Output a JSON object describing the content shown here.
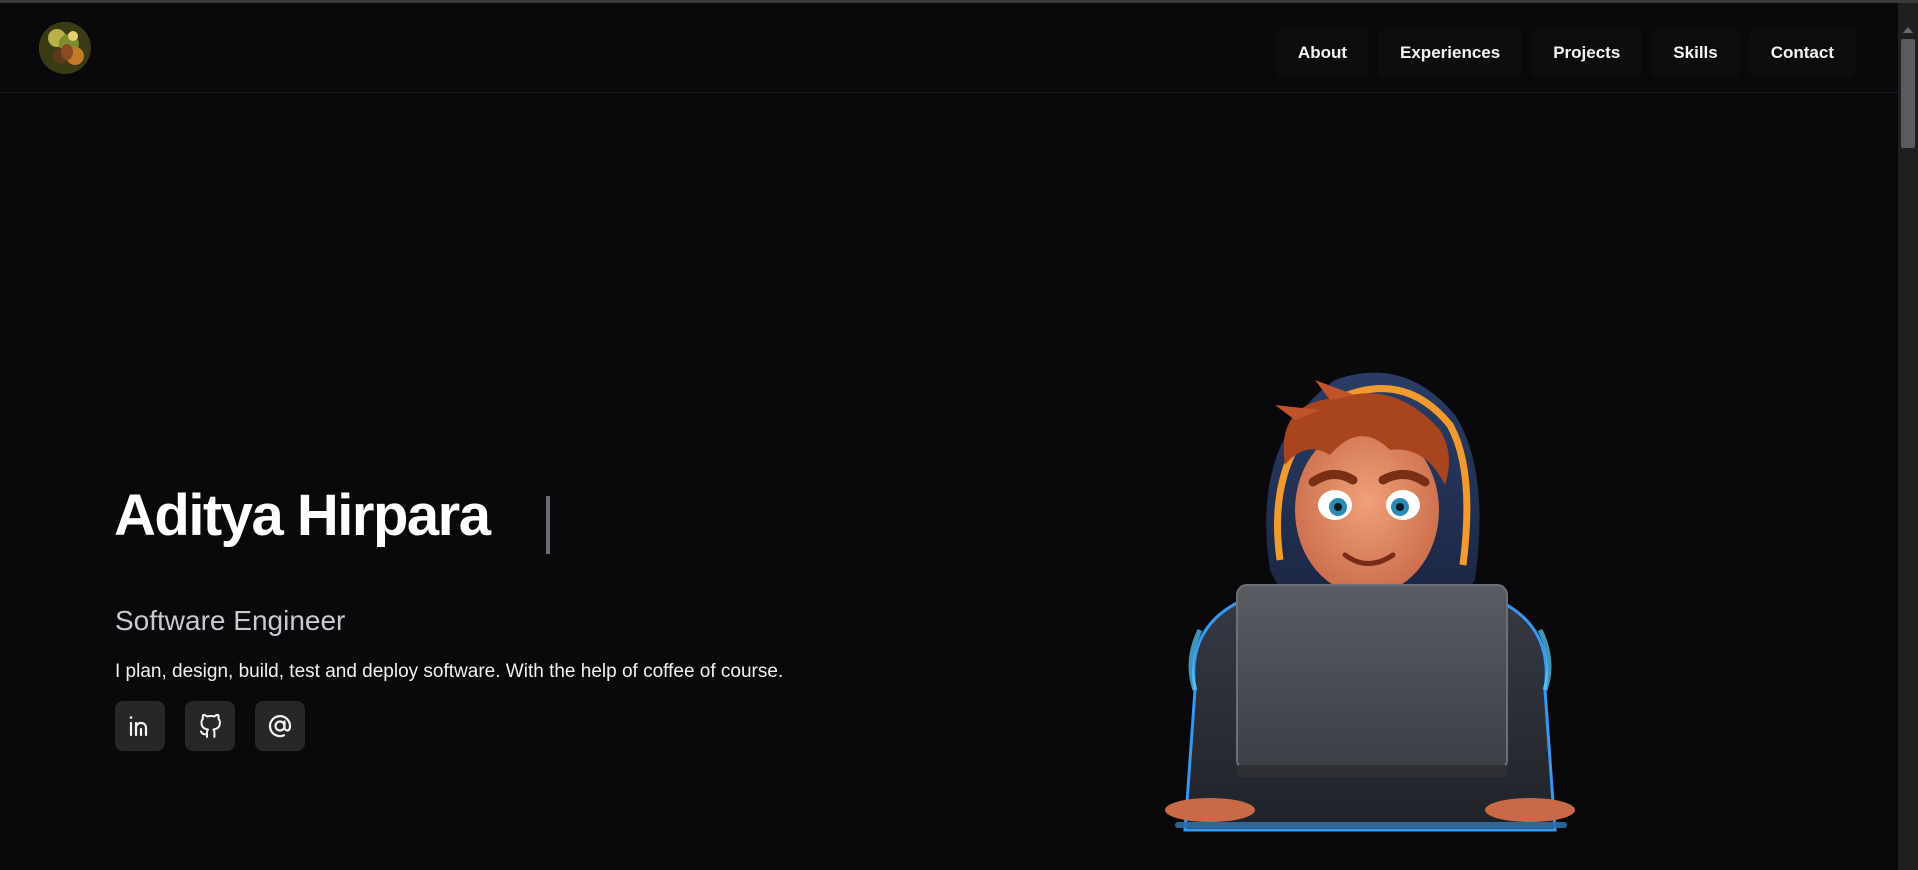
{
  "header": {
    "logo_alt": "profile logo",
    "nav": [
      {
        "label": "About"
      },
      {
        "label": "Experiences"
      },
      {
        "label": "Projects"
      },
      {
        "label": "Skills"
      },
      {
        "label": "Contact"
      }
    ]
  },
  "hero": {
    "name": "Aditya Hirpara",
    "role": "Software Engineer",
    "description": "I plan, design, build, test and deploy software. With the help of coffee of course.",
    "socials": [
      {
        "icon": "linkedin-icon"
      },
      {
        "icon": "github-icon"
      },
      {
        "icon": "email-at-icon"
      }
    ]
  },
  "colors": {
    "background": "#09090b",
    "nav_bg": "#0d0d10",
    "social_bg": "#27272a",
    "text_primary": "#ffffff",
    "text_secondary": "#c9c9ce"
  }
}
